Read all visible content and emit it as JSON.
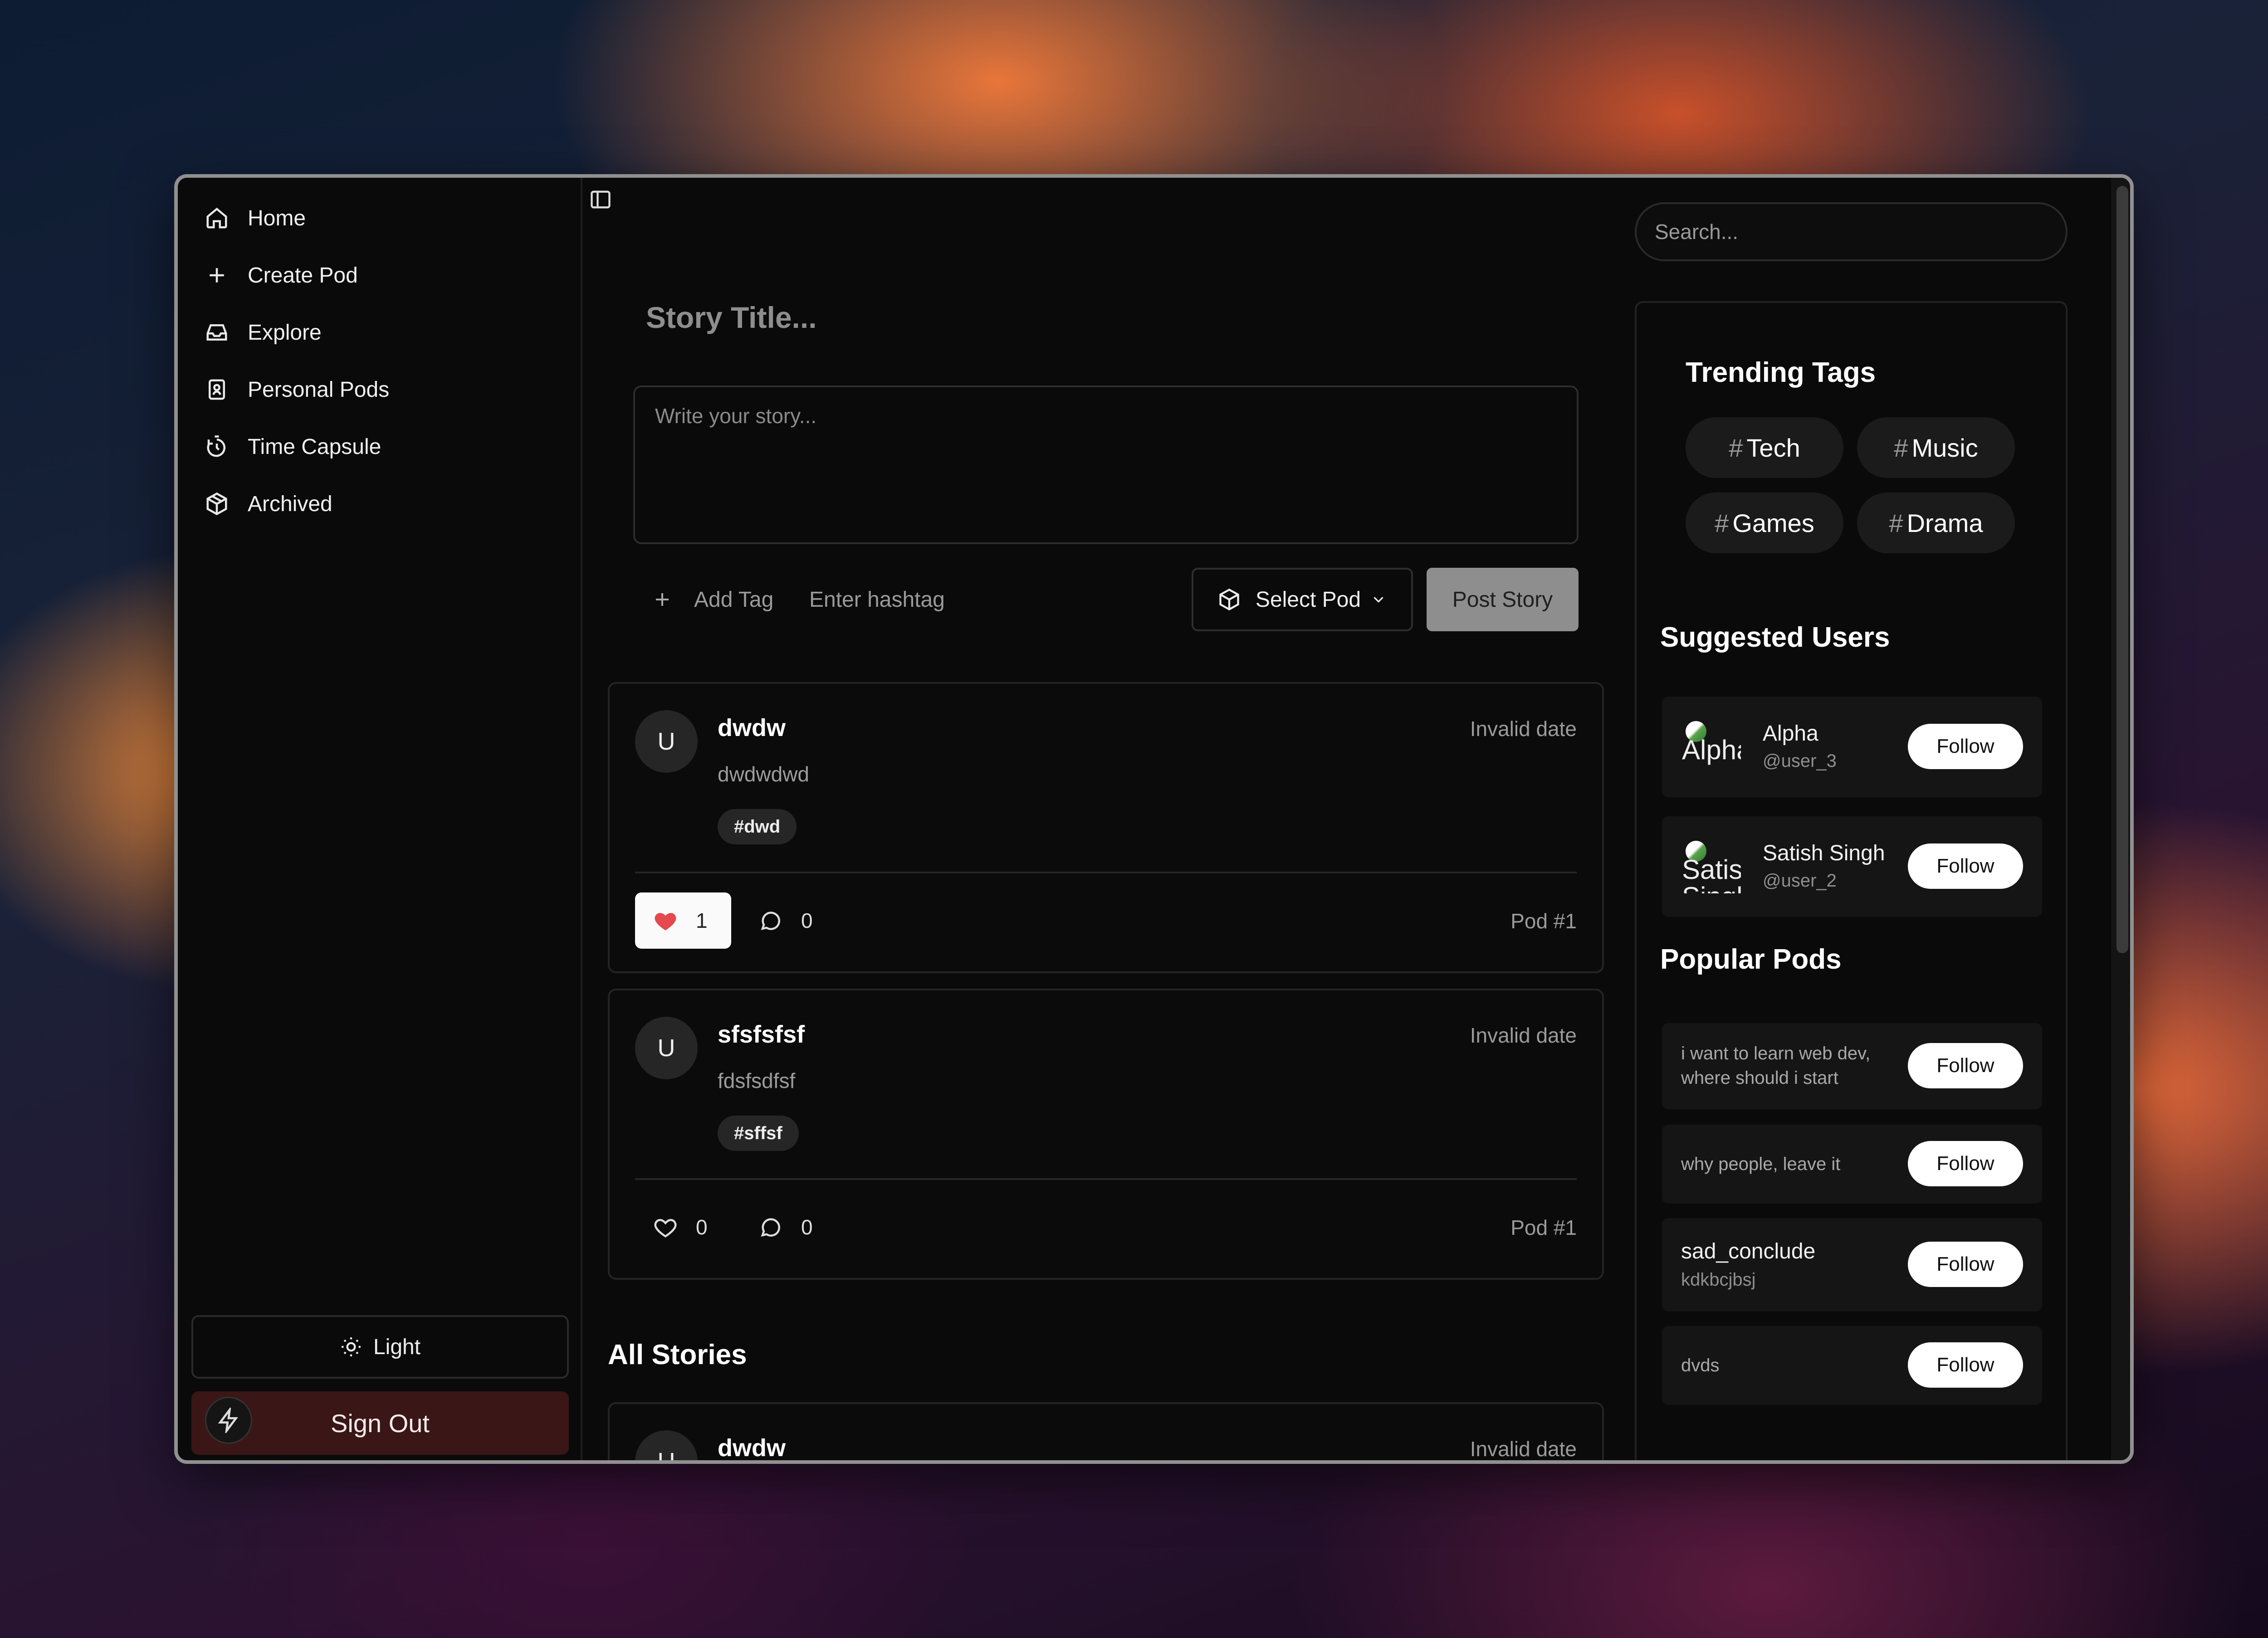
{
  "sidebar": {
    "nav": [
      {
        "label": "Home",
        "icon": "home-icon"
      },
      {
        "label": "Create Pod",
        "icon": "plus-icon"
      },
      {
        "label": "Explore",
        "icon": "inbox-icon"
      },
      {
        "label": "Personal Pods",
        "icon": "id-badge-icon"
      },
      {
        "label": "Time Capsule",
        "icon": "timer-icon"
      },
      {
        "label": "Archived",
        "icon": "package-icon"
      }
    ],
    "theme_label": "Light",
    "signout_label": "Sign Out"
  },
  "composer": {
    "title_placeholder": "Story Title...",
    "body_placeholder": "Write your story...",
    "add_tag_label": "Add Tag",
    "hashtag_placeholder": "Enter hashtag",
    "select_pod_label": "Select Pod",
    "post_label": "Post Story"
  },
  "feed": [
    {
      "avatar": "U",
      "author": "dwdw",
      "date": "Invalid date",
      "content": "dwdwdwd",
      "tag": "#dwd",
      "likes": "1",
      "liked": true,
      "comments": "0",
      "pod": "Pod #1"
    },
    {
      "avatar": "U",
      "author": "sfsfsfsf",
      "date": "Invalid date",
      "content": "fdsfsdfsf",
      "tag": "#sffsf",
      "likes": "0",
      "liked": false,
      "comments": "0",
      "pod": "Pod #1"
    }
  ],
  "all_stories": {
    "title": "All Stories",
    "first": {
      "avatar": "U",
      "author": "dwdw",
      "date": "Invalid date"
    }
  },
  "right": {
    "search_placeholder": "Search...",
    "trending_title": "Trending Tags",
    "trending": [
      "Tech",
      "Music",
      "Games",
      "Drama"
    ],
    "suggested_title": "Suggested Users",
    "users": [
      {
        "avatar_alt": "Alpha",
        "name": "Alpha",
        "handle": "@user_3",
        "follow": "Follow"
      },
      {
        "avatar_alt": "Satish Singh",
        "name": "Satish Singh",
        "handle": "@user_2",
        "follow": "Follow"
      }
    ],
    "popular_title": "Popular Pods",
    "pods": [
      {
        "text": "i want to learn web dev, where should i start",
        "title": "",
        "sub": "",
        "follow": "Follow"
      },
      {
        "text": "why people, leave it",
        "title": "",
        "sub": "",
        "follow": "Follow"
      },
      {
        "text": "",
        "title": "sad_conclude",
        "sub": "kdkbcjbsj",
        "follow": "Follow"
      },
      {
        "text": "dvds",
        "title": "",
        "sub": "",
        "follow": "Follow"
      }
    ]
  },
  "colors": {
    "like_heart": "#e5484d",
    "post_button": "#8e8e8e",
    "signout_bg": "#3a1616"
  }
}
